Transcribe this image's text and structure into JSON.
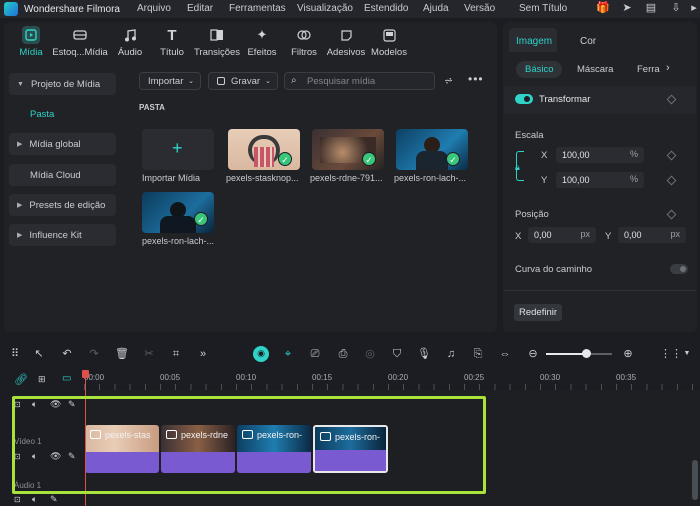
{
  "app": {
    "name": "Wondershare Filmora",
    "window_title": "Sem Título"
  },
  "menu": [
    "Arquivo",
    "Editar",
    "Ferramentas",
    "Visualização",
    "Estendido",
    "Ajuda",
    "Versão"
  ],
  "toolbar": [
    "Mídia",
    "Estoq...Mídia",
    "Áudio",
    "Título",
    "Transições",
    "Efeitos",
    "Filtros",
    "Adesivos",
    "Modelos"
  ],
  "sidebar": {
    "items": [
      "Projeto de Mídia",
      "Pasta",
      "Mídia global",
      "Mídia Cloud",
      "Presets de edição",
      "Influence Kit"
    ]
  },
  "media": {
    "import_label": "Importar",
    "record_label": "Gravar",
    "search_placeholder": "Pesquisar mídia",
    "folder_label": "PASTA",
    "items": [
      "Importar Mídia",
      "pexels-stasknop...",
      "pexels-rdne-791...",
      "pexels-ron-lach-...",
      "pexels-ron-lach-..."
    ]
  },
  "right_panel": {
    "tabs": [
      "Imagem",
      "Cor"
    ],
    "subtabs": [
      "Básico",
      "Máscara",
      "Ferra"
    ],
    "transform_label": "Transformar",
    "scale_label": "Escala",
    "x_label": "X",
    "y_label": "Y",
    "scale_x": "100,00",
    "scale_y": "100,00",
    "percent": "%",
    "position_label": "Posição",
    "pos_x": "0,00",
    "pos_y": "0,00",
    "px": "px",
    "path_curve_label": "Curva do caminho",
    "reset_label": "Redefinir"
  },
  "timeline": {
    "ticks": [
      "00:00",
      "00:05",
      "00:10",
      "00:15",
      "00:20",
      "00:25",
      "00:30",
      "00:35"
    ],
    "video_track_label": "Vídeo 1",
    "audio_track_label": "Áudio 1",
    "clips": [
      "pexels-stas",
      "pexels-rdne",
      "pexels-ron-",
      "pexels-ron-"
    ]
  },
  "colors": {
    "accent": "#2fd3c8",
    "highlight": "#a8e23a",
    "clip_bar": "#7a5ad0"
  }
}
